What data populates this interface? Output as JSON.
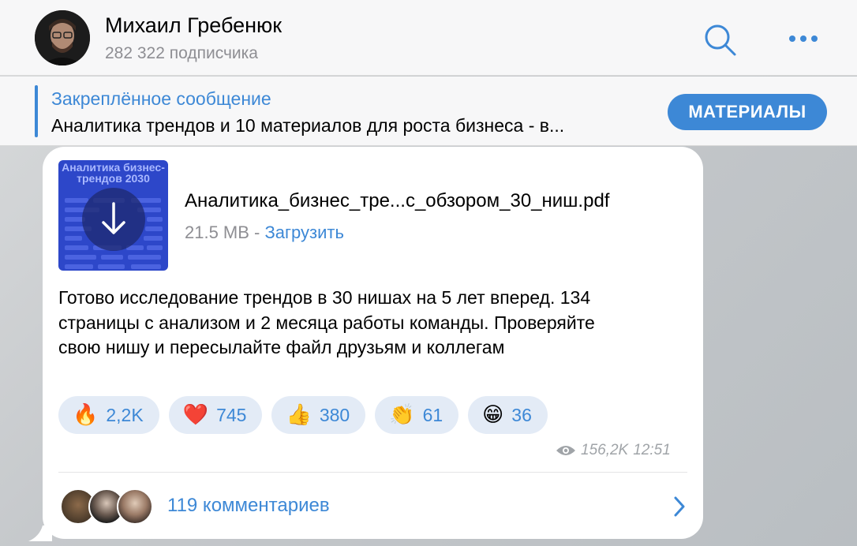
{
  "header": {
    "channel_name": "Михаил Гребенюк",
    "subscribers": "282 322 подписчика",
    "search_icon": "search-icon",
    "more_icon": "more-icon"
  },
  "pinned": {
    "title": "Закреплённое сообщение",
    "text": "Аналитика трендов и 10 материалов для роста бизнеса - в...",
    "button_label": "МАТЕРИАЛЫ"
  },
  "post": {
    "file": {
      "thumb_title": "Аналитика бизнес-трендов 2030",
      "name": "Аналитика_бизнес_тре...с_обзором_30_ниш.pdf",
      "size": "21.5 MB",
      "separator": " - ",
      "download_label": "Загрузить"
    },
    "text": "Готово исследование трендов в 30 нишах на 5 лет вперед. 134 страницы с анализом и 2 месяца работы команды. Проверяйте свою нишу и пересылайте файл друзьям и коллегам",
    "reactions": [
      {
        "emoji": "🔥",
        "count": "2,2K"
      },
      {
        "emoji": "❤️",
        "count": "745"
      },
      {
        "emoji": "👍",
        "count": "380"
      },
      {
        "emoji": "👏",
        "count": "61"
      },
      {
        "emoji": "😁",
        "count": "36"
      }
    ],
    "views": "156,2K",
    "time": "12:51",
    "comments_label": "119 комментариев"
  },
  "colors": {
    "accent": "#3d88d6",
    "reaction_bg": "#e3ebf6",
    "muted": "#8e8e93"
  }
}
